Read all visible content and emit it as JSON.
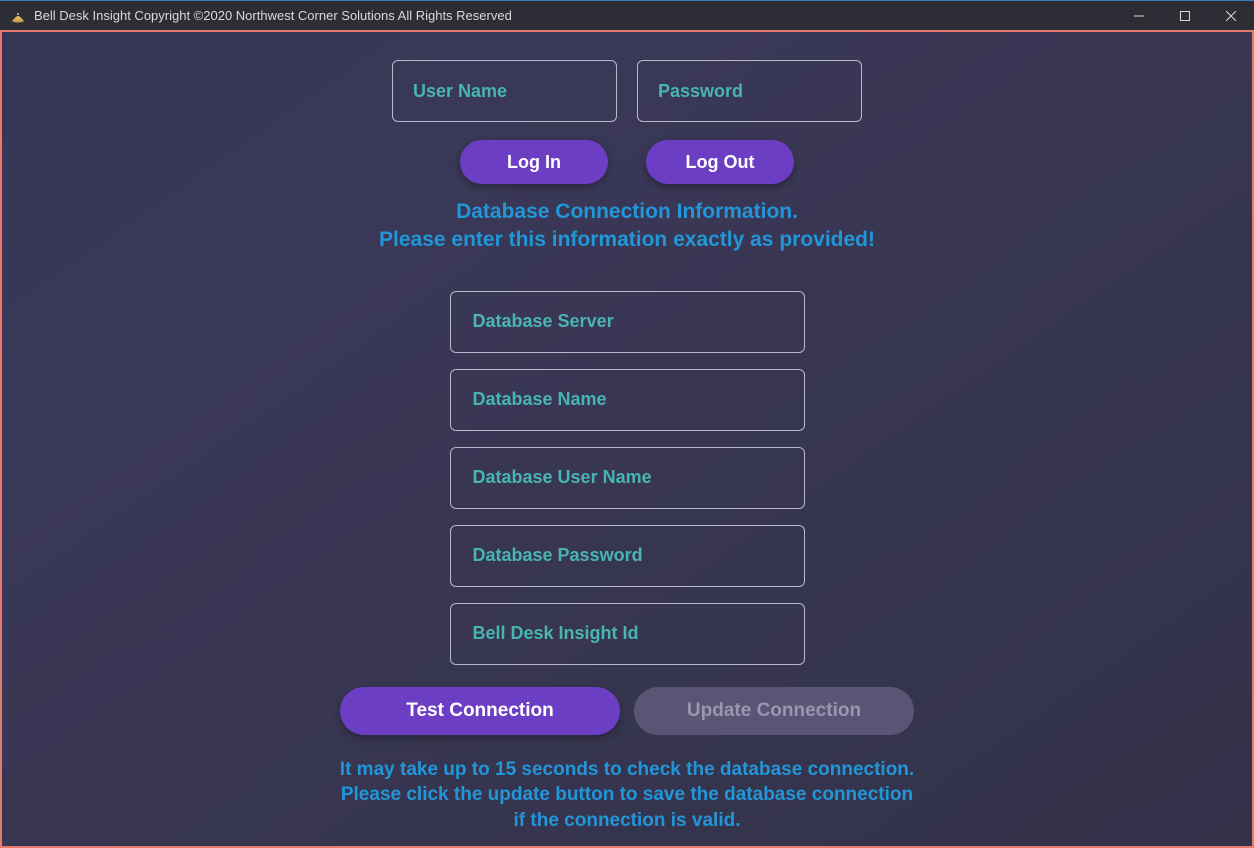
{
  "window": {
    "title": "Bell Desk Insight Copyright ©2020 Northwest Corner Solutions All Rights Reserved"
  },
  "auth": {
    "username_placeholder": "User Name",
    "password_placeholder": "Password",
    "login_label": "Log In",
    "logout_label": "Log Out"
  },
  "db_info": {
    "heading_line1": "Database Connection Information.",
    "heading_line2": "Please enter this information exactly as provided!",
    "server_placeholder": "Database Server",
    "name_placeholder": "Database Name",
    "username_placeholder": "Database User Name",
    "password_placeholder": "Database Password",
    "id_placeholder": "Bell Desk Insight Id",
    "test_label": "Test Connection",
    "update_label": "Update Connection",
    "footer_line1": "It may take up to 15 seconds to check the database connection.",
    "footer_line2": "Please click the update button to save the database connection",
    "footer_line3": "if the connection is valid."
  }
}
